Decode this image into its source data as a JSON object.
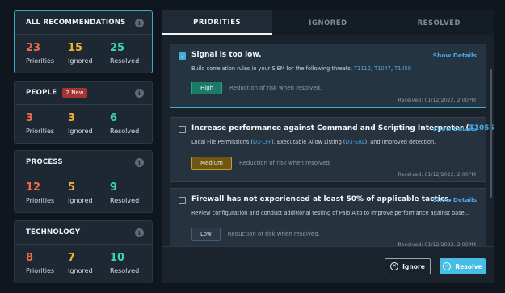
{
  "categories": [
    {
      "title": "ALL RECOMMENDATIONS",
      "badge": "",
      "stats": [
        {
          "value": "23",
          "label": "Priorities"
        },
        {
          "value": "15",
          "label": "Ignored"
        },
        {
          "value": "25",
          "label": "Resolved"
        }
      ]
    },
    {
      "title": "PEOPLE",
      "badge": "2 New",
      "stats": [
        {
          "value": "3",
          "label": "Priorities"
        },
        {
          "value": "3",
          "label": "Ignored"
        },
        {
          "value": "6",
          "label": "Resolved"
        }
      ]
    },
    {
      "title": "PROCESS",
      "badge": "",
      "stats": [
        {
          "value": "12",
          "label": "Priorities"
        },
        {
          "value": "5",
          "label": "Ignored"
        },
        {
          "value": "9",
          "label": "Resolved"
        }
      ]
    },
    {
      "title": "TECHNOLOGY",
      "badge": "",
      "stats": [
        {
          "value": "8",
          "label": "Priorities"
        },
        {
          "value": "7",
          "label": "Ignored"
        },
        {
          "value": "10",
          "label": "Resolved"
        }
      ]
    }
  ],
  "tabs": [
    "PRIORITIES",
    "IGNORED",
    "RESOLVED"
  ],
  "recommendations": [
    {
      "title": "Signal is too low.",
      "title_link": "",
      "title_suffix": "",
      "show_details": "Show Details",
      "desc": [
        {
          "text": "Build correlation rules in your SIEM for the following threats: "
        },
        {
          "text": "T1112",
          "link": true
        },
        {
          "text": ", "
        },
        {
          "text": "T1047",
          "link": true
        },
        {
          "text": ", "
        },
        {
          "text": "T1059",
          "link": true
        }
      ],
      "severity": "High",
      "severity_text": "Reduction of risk when resolved.",
      "received": "Received: 01/12/2022, 2:00PM",
      "checked": true
    },
    {
      "title": "Increase performance against Command and Scripting Interpreter (",
      "title_link": "T1055",
      "title_suffix": ")",
      "show_details": "Show Details",
      "desc": [
        {
          "text": "Local File Permissions ("
        },
        {
          "text": "D3-LFP",
          "link": true
        },
        {
          "text": "), Executable Allow Listing ("
        },
        {
          "text": "D3-EAL",
          "link": true
        },
        {
          "text": "), and improved detection."
        }
      ],
      "severity": "Medium",
      "severity_text": "Reduction of risk when resolved.",
      "received": "Received: 01/12/2022, 2:00PM",
      "checked": false
    },
    {
      "title": "Firewall has not experienced at least 50% of applicable tactics.",
      "title_link": "",
      "title_suffix": "",
      "show_details": "Show Details",
      "desc": [
        {
          "text": "Review configuration and conduct additional testing of Palo Alto to improve performance against base..."
        }
      ],
      "severity": "Low",
      "severity_text": "Reduction of risk when resolved.",
      "received": "Received: 01/12/2022, 2:00PM",
      "checked": false
    }
  ],
  "actions": {
    "ignore_label": "Ignore",
    "resolve_label": "Resolve"
  },
  "colors": {
    "priorities": "#f16a4a",
    "ignored": "#f2b233",
    "resolved": "#39d9b4",
    "accent": "#45bde4"
  }
}
